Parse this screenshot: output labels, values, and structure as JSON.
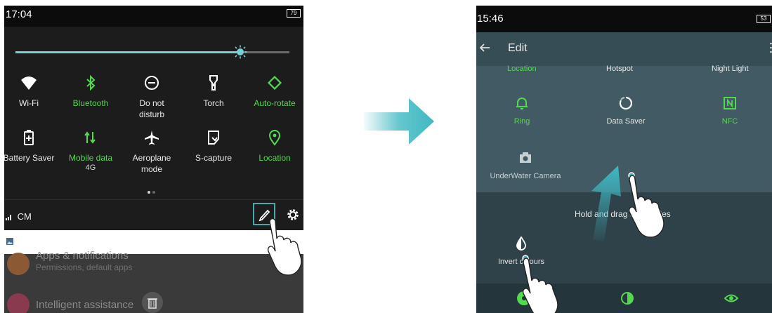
{
  "left": {
    "status": {
      "time": "17:04",
      "battery": "79"
    },
    "brightness_level": 0.82,
    "tiles": [
      {
        "label": "Wi-Fi",
        "sub": "",
        "icon": "wifi-icon",
        "on": false
      },
      {
        "label": "Bluetooth",
        "sub": "",
        "icon": "bluetooth-icon",
        "on": true
      },
      {
        "label": "Do not disturb",
        "sub": "",
        "icon": "do-not-disturb-icon",
        "on": false
      },
      {
        "label": "Torch",
        "sub": "",
        "icon": "torch-icon",
        "on": false
      },
      {
        "label": "Auto-rotate",
        "sub": "",
        "icon": "auto-rotate-icon",
        "on": true
      },
      {
        "label": "Battery Saver",
        "sub": "",
        "icon": "battery-saver-icon",
        "on": false
      },
      {
        "label": "Mobile data",
        "sub": "4G",
        "icon": "mobile-data-icon",
        "on": true
      },
      {
        "label": "Aeroplane mode",
        "sub": "",
        "icon": "aeroplane-icon",
        "on": false
      },
      {
        "label": "S-capture",
        "sub": "",
        "icon": "screenshot-icon",
        "on": false
      },
      {
        "label": "Location",
        "sub": "",
        "icon": "location-icon",
        "on": true
      }
    ],
    "carrier": "CM",
    "settings_rows": [
      {
        "title": "Apps & notifications",
        "sub": "Permissions, default apps"
      },
      {
        "title": "Intelligent assistance",
        "sub": ""
      }
    ]
  },
  "right": {
    "status": {
      "time": "15:46",
      "battery": "53"
    },
    "title": "Edit",
    "top_cut_labels": [
      "Location",
      "Hotspot",
      "Night Light"
    ],
    "tiles": [
      {
        "label": "Ring",
        "icon": "bell-icon",
        "state": "on"
      },
      {
        "label": "Data Saver",
        "icon": "data-saver-icon",
        "state": "off"
      },
      {
        "label": "NFC",
        "icon": "nfc-icon",
        "state": "on"
      },
      {
        "label": "UnderWater Camera",
        "icon": "camera-icon",
        "state": "dim"
      }
    ],
    "hint": "Hold and drag to add tiles",
    "dragged_tile": {
      "label": "Invert colours",
      "icon": "invert-colours-icon"
    }
  },
  "colors": {
    "active_green": "#52d94e",
    "accent_teal": "#3fb8c2",
    "edit_bg": "#415a63"
  }
}
